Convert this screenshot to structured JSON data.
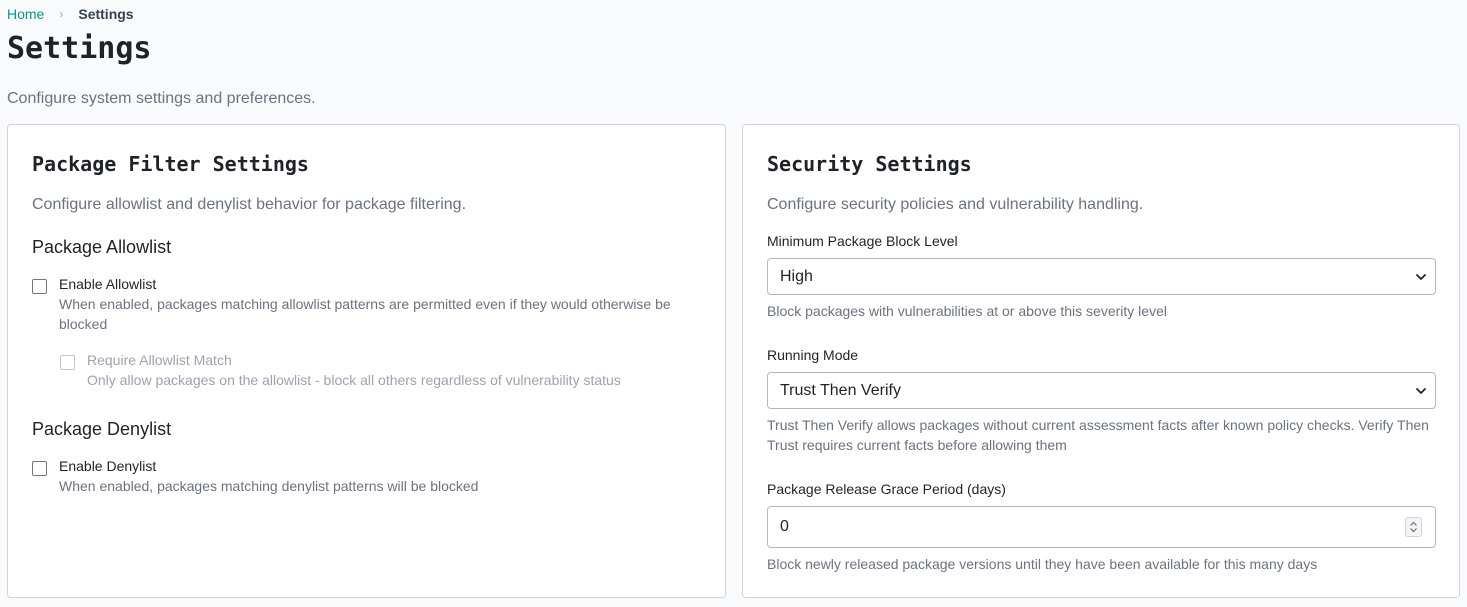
{
  "breadcrumb": {
    "home": "Home",
    "separator": "›",
    "current": "Settings"
  },
  "page": {
    "title": "Settings",
    "subtitle": "Configure system settings and preferences."
  },
  "package_filter": {
    "title": "Package Filter Settings",
    "description": "Configure allowlist and denylist behavior for package filtering.",
    "allowlist": {
      "heading": "Package Allowlist",
      "enable_label": "Enable Allowlist",
      "enable_checked": false,
      "enable_help": "When enabled, packages matching allowlist patterns are permitted even if they would otherwise be blocked",
      "require_label": "Require Allowlist Match",
      "require_checked": false,
      "require_disabled": true,
      "require_help": "Only allow packages on the allowlist - block all others regardless of vulnerability status"
    },
    "denylist": {
      "heading": "Package Denylist",
      "enable_label": "Enable Denylist",
      "enable_checked": false,
      "enable_help": "When enabled, packages matching denylist patterns will be blocked"
    }
  },
  "security": {
    "title": "Security Settings",
    "description": "Configure security policies and vulnerability handling.",
    "block_level": {
      "label": "Minimum Package Block Level",
      "value": "High",
      "help": "Block packages with vulnerabilities at or above this severity level"
    },
    "running_mode": {
      "label": "Running Mode",
      "value": "Trust Then Verify",
      "help": "Trust Then Verify allows packages without current assessment facts after known policy checks. Verify Then Trust requires current facts before allowing them"
    },
    "grace_period": {
      "label": "Package Release Grace Period (days)",
      "value": "0",
      "help": "Block newly released package versions until they have been available for this many days"
    }
  },
  "icons": {
    "breadcrumb_separator": "chevron-right-icon",
    "select_arrow": "chevron-down-icon",
    "number_spinner": "spinner-arrows-icon"
  },
  "colors": {
    "link": "#0d9488",
    "muted_text": "#6b7280",
    "disabled_text": "#9ca3af",
    "border": "#d1d5db",
    "page_background": "#f9fafb"
  }
}
